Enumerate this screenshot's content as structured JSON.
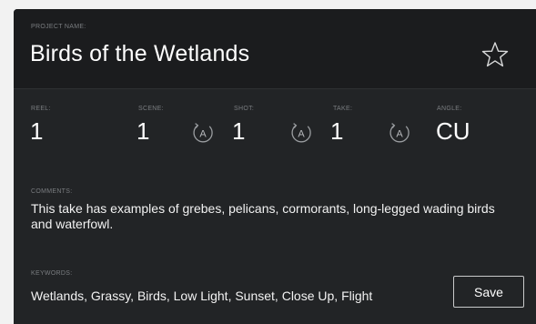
{
  "project": {
    "label": "PROJECT NAME:",
    "name": "Birds of the Wetlands"
  },
  "metadata": {
    "reel": {
      "label": "REEL:",
      "value": "1"
    },
    "scene": {
      "label": "SCENE:",
      "value": "1"
    },
    "shot": {
      "label": "SHOT:",
      "value": "1"
    },
    "take": {
      "label": "TAKE:",
      "value": "1"
    },
    "angle": {
      "label": "ANGLE:",
      "value": "CU"
    },
    "auto_button_glyph": "A"
  },
  "comments": {
    "label": "COMMENTS:",
    "text": "This take has examples of grebes, pelicans, cormorants, long-legged wading birds and waterfowl."
  },
  "keywords": {
    "label": "KEYWORDS:",
    "text": "Wetlands, Grassy, Birds, Low Light, Sunset, Close Up, Flight"
  },
  "actions": {
    "save_label": "Save"
  },
  "icons": {
    "favorite": "star-outline-icon",
    "auto_increment": "auto-increment-icon"
  },
  "colors": {
    "panel_bg": "#222426",
    "header_bg": "#1b1c1e",
    "label": "#7a7d80",
    "text": "#ffffff"
  }
}
